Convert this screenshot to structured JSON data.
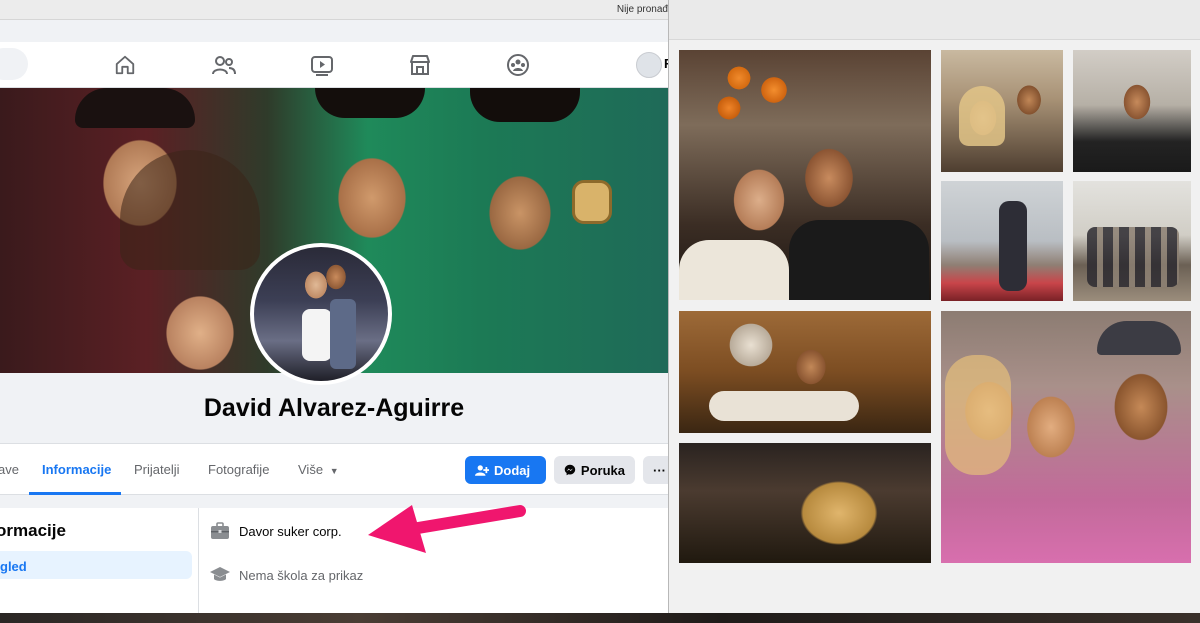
{
  "system": {
    "not_found_text": "Nije pronađ"
  },
  "nav": {
    "icons": [
      "home-icon",
      "friends-icon",
      "watch-icon",
      "marketplace-icon",
      "groups-icon"
    ],
    "user_initial": "F"
  },
  "profile": {
    "name": "David Alvarez-Aguirre"
  },
  "tabs": {
    "items": [
      "ave",
      "Informacije",
      "Prijatelji",
      "Fotografije",
      "Više"
    ],
    "active": "Informacije"
  },
  "actions": {
    "add_label": "Dodaj",
    "message_label": "Poruka",
    "more_label": "···"
  },
  "about": {
    "title": "ormacije",
    "side_item": "gled",
    "work": "Davor suker corp.",
    "school": "Nema škola za prikaz"
  },
  "colors": {
    "facebook_blue": "#1877f2",
    "arrow_pink": "#f0166e",
    "tab_text": "#65676b"
  }
}
